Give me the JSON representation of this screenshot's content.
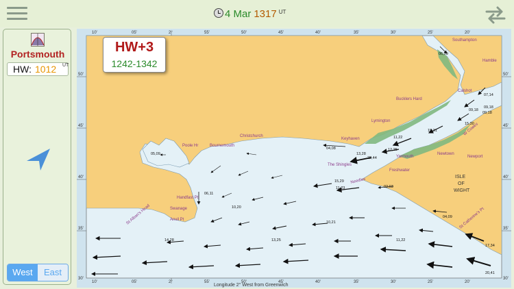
{
  "header": {
    "date": "4 Mar",
    "time": "1317",
    "time_unit": "UT"
  },
  "sidebar": {
    "port_name": "Portsmouth",
    "hw_label": "HW:",
    "hw_value": "1012",
    "hw_unit": "UT",
    "toggle": {
      "west": "West",
      "east": "East",
      "selected": "West"
    }
  },
  "tide_card": {
    "title": "HW+3",
    "time_range": "1242-1342"
  },
  "map": {
    "longitude_caption": "Longitude 2° West from Greenwich",
    "top_ticks": [
      "10'",
      "05'",
      "2°",
      "55'",
      "50'",
      "45'",
      "40'",
      "35'",
      "30'",
      "25'",
      "20'"
    ],
    "bottom_ticks": [
      "10'",
      "05'",
      "2°",
      "55'",
      "50'",
      "45'",
      "40'",
      "35'",
      "30'",
      "25'",
      "20'"
    ],
    "left_ticks": [
      "50'",
      "45'",
      "40'",
      "35'",
      "30'"
    ],
    "right_ticks": [
      "50'",
      "45'",
      "40'",
      "35'",
      "30'"
    ],
    "places": {
      "southampton": "Southampton",
      "hamble": "Hamble",
      "calshot": "Calshot",
      "bucklers_hard": "Bucklers Hard",
      "lymington": "Lymington",
      "christchurch": "Christchurch",
      "bournemouth": "Bournemouth",
      "poole": "Poole Hr",
      "keyhaven": "Keyhaven",
      "yarmouth": "Yarmouth",
      "newtown": "Newtown",
      "newport": "Newport",
      "freshwater": "Freshwater",
      "the_shingles": "The Shingles",
      "needles": "Needles",
      "isle": "ISLE",
      "of": "OF",
      "wight": "WIGHT",
      "handfast": "Handfast Pt",
      "swanage": "Swanage",
      "anvil": "Anvil Pt",
      "st_albans": "St Alban's Head",
      "st_catherines": "St Catherine's Pt",
      "w_cowes": "W Cowes"
    },
    "rates": {
      "r1": "06,09",
      "r2": "07,14",
      "r3": "09,18",
      "r4": "09,18",
      "r5": "09,18",
      "r6": "15,30",
      "r7": "15,31",
      "r8": "11,22",
      "r9": "12,25",
      "r10": "22,44",
      "r11": "13,28",
      "r12": "04,08",
      "r13": "05,09",
      "r14": "06,11",
      "r15": "15,29",
      "r16": "11,23",
      "r17": "02,03",
      "r18": "10,20",
      "r19": "10,21",
      "r20": "14,28",
      "r21": "13,25",
      "r22": "11,22",
      "r23": "04,09",
      "r24": "17,34",
      "r25": "20,41"
    }
  },
  "colors": {
    "land": "#f7cf7c",
    "sea": "#e4f1f7",
    "mud": "#7fb87f",
    "frame": "#cfe3ee",
    "accent": "#5aa8f0"
  }
}
